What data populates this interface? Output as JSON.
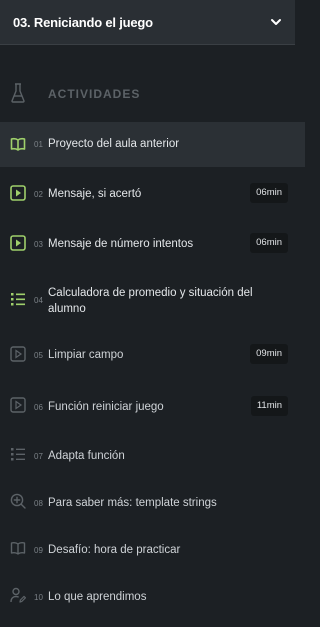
{
  "header": {
    "title": "03. Reniciando el juego"
  },
  "section": {
    "label": "ACTIVIDADES"
  },
  "colors": {
    "accent": "#9fd06b",
    "muted": "#5c6267",
    "background": "#1c2024"
  },
  "items": [
    {
      "num": "01",
      "title": "Proyecto del aula anterior",
      "icon": "book-icon",
      "duration": ""
    },
    {
      "num": "02",
      "title": "Mensaje, si acertó",
      "icon": "video-icon",
      "duration": "06min"
    },
    {
      "num": "03",
      "title": "Mensaje de número intentos",
      "icon": "video-icon",
      "duration": "06min"
    },
    {
      "num": "04",
      "title": "Calculadora de promedio y situación del",
      "title2": "alumno",
      "icon": "list-icon",
      "duration": ""
    },
    {
      "num": "05",
      "title": "Limpiar campo",
      "icon": "video-icon",
      "duration": "09min"
    },
    {
      "num": "06",
      "title": "Función reiniciar juego",
      "icon": "video-icon",
      "duration": "11min"
    },
    {
      "num": "07",
      "title": "Adapta función",
      "icon": "list-icon",
      "duration": ""
    },
    {
      "num": "08",
      "title": "Para saber más: template strings",
      "icon": "plus-search-icon",
      "duration": ""
    },
    {
      "num": "09",
      "title": "Desafío: hora de practicar",
      "icon": "book-icon",
      "duration": ""
    },
    {
      "num": "10",
      "title": "Lo que aprendimos",
      "icon": "person-edit-icon",
      "duration": ""
    }
  ]
}
